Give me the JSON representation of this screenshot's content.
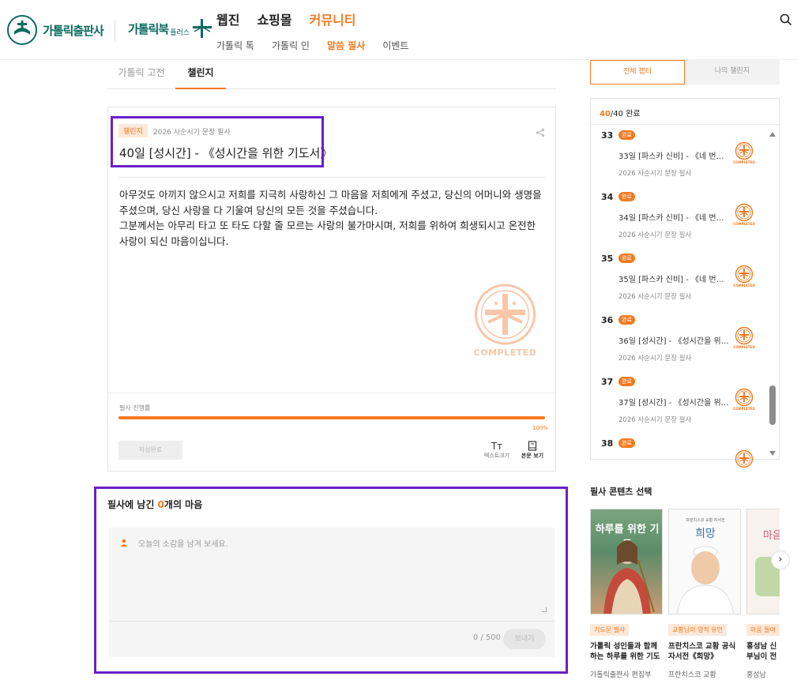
{
  "header": {
    "logo1_text": "가톨릭출판사",
    "logo2_text": "가톨릭북",
    "logo2_plus": "플러스",
    "gnb": [
      {
        "label": "웹진",
        "active": false
      },
      {
        "label": "쇼핑몰",
        "active": false
      },
      {
        "label": "커뮤니티",
        "active": true
      }
    ],
    "lnb": [
      {
        "label": "가톨릭 톡",
        "active": false
      },
      {
        "label": "가톨릭 인",
        "active": false
      },
      {
        "label": "말씀 필사",
        "active": true
      },
      {
        "label": "이벤트",
        "active": false
      }
    ],
    "search_icon": "search-icon"
  },
  "tabs": [
    "가톨릭 고전",
    "챌린지"
  ],
  "card": {
    "badge": "챌린지",
    "category": "2026 사순시기 문장 필사",
    "title": "40일 [성시간] - 《성시간을 위한 기도서》",
    "body": "아무것도 아끼지 않으시고 저희를 지극히 사랑하신 그 마음을 저희에게 주셨고, 당신의 어머니와 생명을 주셨으며, 당신 사랑을 다 기울여 당신의 모든 것을 주셨습니다.\n그분께서는 아무리 타고 또 타도 다할 줄 모르는 사랑의 불가마시며, 저희를 위하여 희생되시고 온전한 사랑이 되신 마음이십니다.",
    "stamp_text": "COMPLETED",
    "progress_label": "필사 진행률",
    "progress_value": 100,
    "progress_text": "100%",
    "done_button": "작성완료",
    "text_size_icon": "Tт",
    "text_size_label": "텍스트크기",
    "view_text_label": "본문 보기"
  },
  "comments": {
    "title_prefix": "필사에 남긴 ",
    "count": "0",
    "title_suffix": "개의 마음",
    "placeholder": "오늘의 소감을 남겨 보세요.",
    "char_count": "0 / 500",
    "send_label": "보내기"
  },
  "side": {
    "seg_all": "전체 챕터",
    "seg_mine": "나의 챌린지",
    "done_count": "40",
    "total_suffix": "/40 완료",
    "entries": [
      {
        "num": "33",
        "tag": "완료",
        "title": "33일 [파스카 신비] - 《네 번째 ...",
        "sub": "2026 사순시기 문장 필사"
      },
      {
        "num": "34",
        "tag": "완료",
        "title": "34일 [파스카 신비] - 《네 번째 ...",
        "sub": "2026 사순시기 문장 필사"
      },
      {
        "num": "35",
        "tag": "완료",
        "title": "35일 [파스카 신비] - 《네 번째 ...",
        "sub": "2026 사순시기 문장 필사"
      },
      {
        "num": "36",
        "tag": "완료",
        "title": "36일 [성시간] - 《성시간을 위한...",
        "sub": "2026 사순시기 문장 필사"
      },
      {
        "num": "37",
        "tag": "완료",
        "title": "37일 [성시간] - 《성시간을 위한...",
        "sub": "2026 사순시기 문장 필사"
      },
      {
        "num": "38",
        "tag": "완료",
        "title": "",
        "sub": ""
      }
    ],
    "mini_stamp_text": "COMPLETED"
  },
  "content_select": {
    "title": "필사 콘텐츠 선택",
    "books": [
      {
        "cover_title": "하루를 위한 기도",
        "tag": "기도문 필사",
        "name": "가톨릭 성인들과 함께하는 하루를 위한 기도",
        "author": "가톨릭출판사 편집부"
      },
      {
        "cover_title": "희망",
        "cover_sub": "프란치스코 교황 자서전",
        "tag": "교황님의 영적 유언",
        "name": "프란치스코 교황 공식 자서전《희망》",
        "author": "프란치스코 교황"
      },
      {
        "cover_title": "마음",
        "tag": "마음 들여",
        "name": "홍성남 신부님이 전하는 마음 일",
        "author": "홍성남"
      }
    ]
  },
  "colors": {
    "accent": "#f47a20",
    "highlight": "#6b1fc9",
    "brand": "#0c6b5f"
  }
}
